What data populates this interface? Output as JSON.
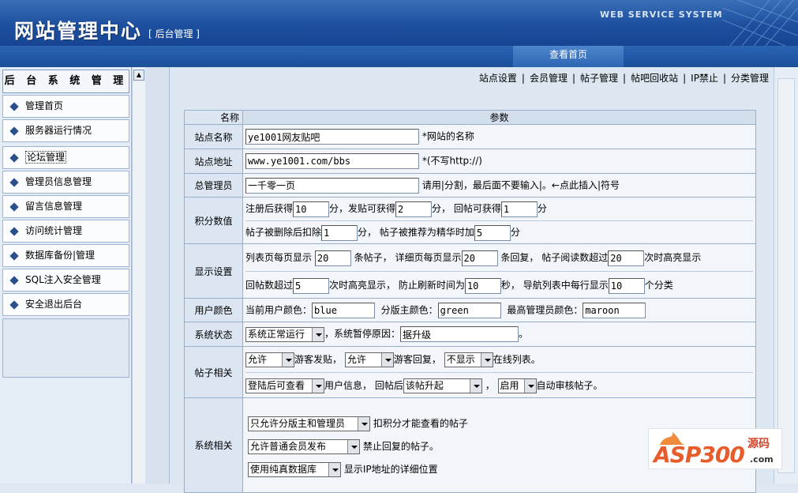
{
  "header": {
    "title": "网站管理中心",
    "subtitle": "[ 后台管理 ]",
    "system_label": "WEB SERVICE SYSTEM",
    "nav_tab": "查看首页"
  },
  "sidebar": {
    "heading": "后 台 系 统 管 理",
    "items": [
      {
        "label": "管理首页"
      },
      {
        "label": "服务器运行情况"
      },
      {
        "label": "论坛管理"
      },
      {
        "label": "管理员信息管理"
      },
      {
        "label": "留言信息管理"
      },
      {
        "label": "访问统计管理"
      },
      {
        "label": "数据库备份|管理"
      },
      {
        "label": "SQL注入安全管理"
      },
      {
        "label": "安全退出后台"
      }
    ]
  },
  "topmenu": {
    "items": [
      "站点设置",
      "会员管理",
      "帖子管理",
      "帖吧回收站",
      "IP禁止",
      "分类管理"
    ],
    "separator": "|"
  },
  "table": {
    "col_name": "名称",
    "col_param": "参数",
    "site_name": {
      "label": "站点名称",
      "value": "ye1001网友贴吧",
      "note": "*网站的名称"
    },
    "site_url": {
      "label": "站点地址",
      "value": "www.ye1001.com/bbs",
      "note": "*(不写http://)"
    },
    "admin": {
      "label": "总管理员",
      "value": "一千零一页",
      "note": "请用|分割，最后面不要输入|。←点此插入|符号"
    },
    "points": {
      "label": "积分数值",
      "register_text": "注册后获得",
      "register_value": "10",
      "unit1": "分，",
      "post_text": "发贴可获得",
      "post_value": "2",
      "unit2": "分，",
      "reply_text": "回帖可获得",
      "reply_value": "1",
      "unit3": "分",
      "deleted_text": "帖子被删除后扣除",
      "deleted_value": "1",
      "unit4": "分，",
      "featured_text": "帖子被推荐为精华时加",
      "featured_value": "5",
      "unit5": "分"
    },
    "display": {
      "label": "显示设置",
      "list_text": "列表页每页显示",
      "list_value": "20",
      "list_unit": "条帖子，",
      "detail_text": "详细页每页显示",
      "detail_value": "20",
      "detail_unit": "条回复，",
      "read_text": "帖子阅读数超过",
      "read_value": "20",
      "read_unit": "次时高亮显示",
      "reply_text": "回帖数超过",
      "reply_value": "5",
      "reply_unit": "次时高亮显示，",
      "refresh_text": "防止刷新时间为",
      "refresh_value": "10",
      "refresh_unit": "秒，",
      "nav_text": "导航列表中每行显示",
      "nav_value": "10",
      "nav_unit": "个分类"
    },
    "colors": {
      "label": "用户颜色",
      "current_text": "当前用户颜色：",
      "current_value": "blue",
      "mod_text": "分版主颜色：",
      "mod_value": "green",
      "admin_text": "最高管理员颜色：",
      "admin_value": "maroon"
    },
    "status": {
      "label": "系统状态",
      "select_value": "系统正常运行",
      "reason_text": "，系统暂停原因：",
      "reason_value": "据升级",
      "end": "。"
    },
    "posts": {
      "label": "帖子相关",
      "guest_post_value": "允许",
      "guest_post_text": "游客发贴，",
      "guest_reply_value": "允许",
      "guest_reply_text": "游客回复，",
      "online_value": "不显示",
      "online_text": "在线列表。",
      "userinfo_value": "登陆后可查看",
      "userinfo_text": "用户信息，",
      "afterreply_text": "回帖后",
      "afterreply_value": "该帖升起",
      "comma": "，",
      "audit_value": "启用",
      "audit_text": "自动审核帖子。"
    },
    "system": {
      "label": "系统相关",
      "view_value": "只允许分版主和管理员",
      "view_text": "扣积分才能查看的帖子",
      "publish_value": "允许普通会员发布",
      "publish_text": "禁止回复的帖子。",
      "ip_value": "使用纯真数据库",
      "ip_text": "显示IP地址的详细位置"
    }
  },
  "watermark": {
    "brand": "ASP300",
    "suffix": "源码",
    "domain": ".com"
  },
  "colors": {
    "header_blue": "#1d4f9e",
    "nav_blue": "#2a64b4",
    "panel_bg": "#dde7f1"
  }
}
